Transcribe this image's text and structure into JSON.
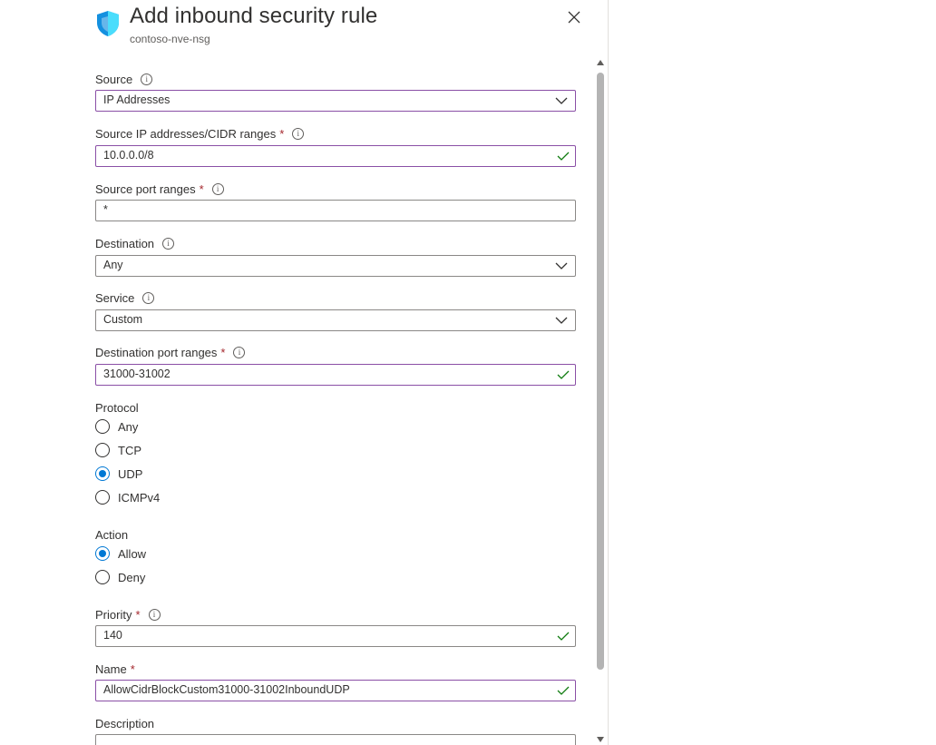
{
  "header": {
    "title": "Add inbound security rule",
    "subtitle": "contoso-nve-nsg",
    "icon": "shield-icon",
    "close_icon": "close-icon"
  },
  "form": {
    "source": {
      "label": "Source",
      "value": "IP Addresses"
    },
    "source_ips": {
      "label": "Source IP addresses/CIDR ranges",
      "required": "*",
      "value": "10.0.0.0/8"
    },
    "source_ports": {
      "label": "Source port ranges",
      "required": "*",
      "value": "*"
    },
    "destination": {
      "label": "Destination",
      "value": "Any"
    },
    "service": {
      "label": "Service",
      "value": "Custom"
    },
    "dest_ports": {
      "label": "Destination port ranges",
      "required": "*",
      "value": "31000-31002"
    },
    "protocol": {
      "label": "Protocol",
      "options": [
        "Any",
        "TCP",
        "UDP",
        "ICMPv4"
      ],
      "selected": "UDP"
    },
    "action": {
      "label": "Action",
      "options": [
        "Allow",
        "Deny"
      ],
      "selected": "Allow"
    },
    "priority": {
      "label": "Priority",
      "required": "*",
      "value": "140"
    },
    "name": {
      "label": "Name",
      "required": "*",
      "value": "AllowCidrBlockCustom31000-31002InboundUDP"
    },
    "description": {
      "label": "Description",
      "value": ""
    }
  },
  "colors": {
    "accent": "#0078d4",
    "required": "#a4262c",
    "valid_check": "#107c10",
    "focus_border": "#8a4fa6"
  }
}
